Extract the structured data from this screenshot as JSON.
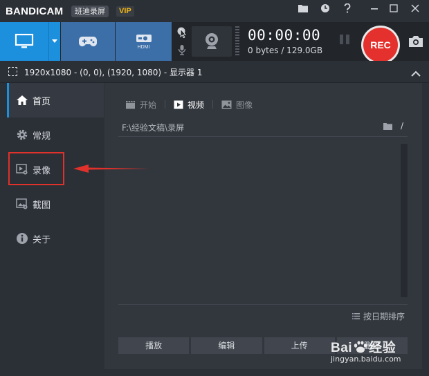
{
  "titlebar": {
    "logo_band": "BANDI",
    "logo_cam": "CAM",
    "edition": "班迪录屏",
    "vip": "VIP"
  },
  "toolbar": {
    "timer": "00:00:00",
    "file_size": "0 bytes / 129.0GB",
    "rec_label": "REC",
    "hdmi_label": "HDMI"
  },
  "target": {
    "text": "1920x1080 - (0, 0), (1920, 1080) - 显示器 1"
  },
  "sidebar": {
    "items": [
      {
        "label": "首页",
        "active": true
      },
      {
        "label": "常规",
        "active": false
      },
      {
        "label": "录像",
        "active": false
      },
      {
        "label": "截图",
        "active": false
      },
      {
        "label": "关于",
        "active": false
      }
    ]
  },
  "main": {
    "tabs": [
      {
        "label": "开始",
        "active": false
      },
      {
        "label": "视频",
        "active": true
      },
      {
        "label": "图像",
        "active": false
      }
    ],
    "path": "F:\\经验文稿\\录屏",
    "path_suffix": "/",
    "sort_label": "按日期排序",
    "buttons": [
      "播放",
      "编辑",
      "上传",
      "删除"
    ]
  },
  "watermark": {
    "brand": "Bai",
    "brand_suffix": "经验",
    "url": "jingyan.baidu.com"
  },
  "colors": {
    "accent": "#1c8fdd",
    "rec_red": "#e5312d",
    "annotation_red": "#e0312b",
    "vip_gold": "#f2b716"
  }
}
